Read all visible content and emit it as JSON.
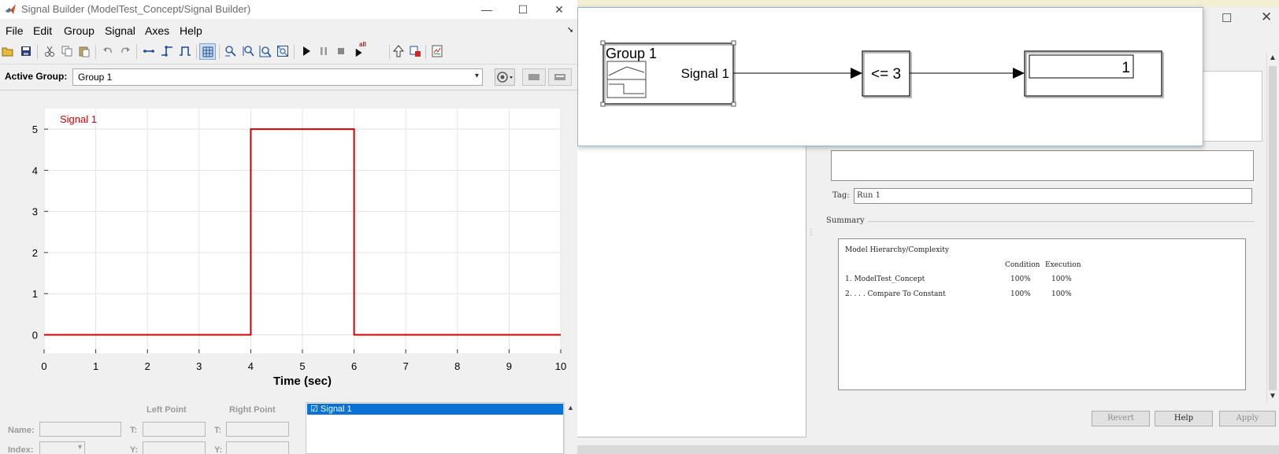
{
  "signal_builder": {
    "title": "Signal Builder (ModelTest_Concept/Signal Builder)",
    "window_controls": {
      "minimize": "—",
      "maximize": "☐",
      "close": "✕"
    },
    "menu": [
      "File",
      "Edit",
      "Group",
      "Signal",
      "Axes",
      "Help"
    ],
    "toolbar_icons": [
      "open-icon",
      "save-icon",
      "cut-icon",
      "copy-icon",
      "paste-icon",
      "undo-icon",
      "redo-icon",
      "line-segment-icon",
      "step-icon",
      "pulse-icon",
      "grid-icon",
      "zoom-x-icon",
      "zoom-y-icon",
      "zoom-xy-icon",
      "zoom-fit-icon",
      "play-icon",
      "pause-icon",
      "stop-icon",
      "run-all-icon",
      "move-up-icon",
      "block-link-icon",
      "report-icon"
    ],
    "run_all_badge": "all",
    "active_group_label": "Active Group:",
    "active_group_value": "Group 1",
    "left_point_label": "Left Point",
    "right_point_label": "Right Point",
    "name_label": "Name:",
    "index_label": "Index:",
    "t_label": "T:",
    "y_label": "Y:",
    "signal_list": [
      "☑ Signal 1"
    ],
    "colors": {
      "signal": "#d40000",
      "selection": "#0a72d4"
    }
  },
  "chart_data": {
    "type": "line",
    "xlabel": "Time (sec)",
    "ylabel": "",
    "xlim": [
      0,
      10
    ],
    "ylim": [
      -0.45,
      5.5
    ],
    "xticks": [
      0,
      1,
      2,
      3,
      4,
      5,
      6,
      7,
      8,
      9,
      10
    ],
    "yticks": [
      0,
      1,
      2,
      3,
      4,
      5
    ],
    "grid": true,
    "series": [
      {
        "name": "Signal 1",
        "x": [
          0,
          4,
          4,
          6,
          6,
          10
        ],
        "y": [
          0,
          0,
          5,
          5,
          0,
          0
        ]
      }
    ]
  },
  "simulink": {
    "group_block_title": "Group 1",
    "group_block_port": "Signal 1",
    "compare_block": "<= 3",
    "display_value": "1"
  },
  "dialog": {
    "tag_label": "Tag:",
    "tag_value": "Run 1",
    "summary_label": "Summary",
    "summary_heading": "Model Hierarchy/Complexity",
    "col_condition": "Condition",
    "col_execution": "Execution",
    "rows": [
      {
        "name": "1. ModelTest_Concept",
        "condition": "100%",
        "execution": "100%"
      },
      {
        "name": "2. . . . Compare To Constant",
        "condition": "100%",
        "execution": "100%"
      }
    ],
    "buttons": {
      "revert": "Revert",
      "help": "Help",
      "apply": "Apply"
    }
  }
}
